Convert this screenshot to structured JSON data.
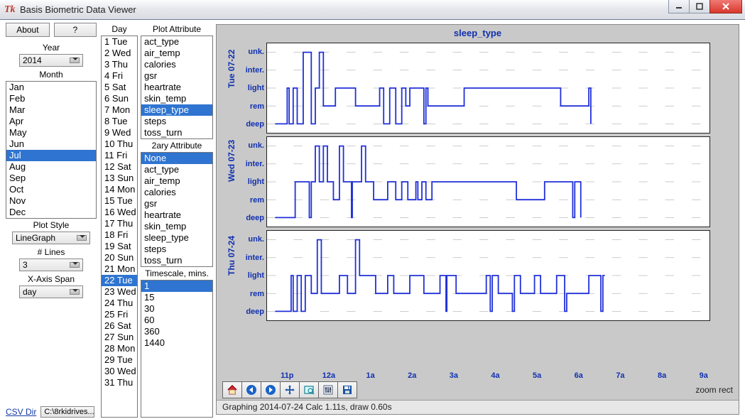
{
  "window": {
    "title": "Basis Biometric Data Viewer"
  },
  "buttons": {
    "about": "About",
    "help": "?",
    "csvdir": "CSV Dir",
    "pathbtn": "C:\\8rkidrives..."
  },
  "headers": {
    "year": "Year",
    "month": "Month",
    "day": "Day",
    "plot_attr": "Plot Attribute",
    "secondary_attr": "2ary Attribute",
    "timescale": "Timescale, mins.",
    "plot_style": "Plot Style",
    "num_lines": "# Lines",
    "xaxis_span": "X-Axis Span"
  },
  "dropdowns": {
    "year": "2014",
    "plot_style": "LineGraph",
    "num_lines": "3",
    "xaxis_span": "day"
  },
  "months": [
    "Jan",
    "Feb",
    "Mar",
    "Apr",
    "May",
    "Jun",
    "Jul",
    "Aug",
    "Sep",
    "Oct",
    "Nov",
    "Dec"
  ],
  "month_selected": "Jul",
  "days": [
    "1 Tue",
    "2 Wed",
    "3 Thu",
    "4 Fri",
    "5 Sat",
    "6 Sun",
    "7 Mon",
    "8 Tue",
    "9 Wed",
    "10 Thu",
    "11 Fri",
    "12 Sat",
    "13 Sun",
    "14 Mon",
    "15 Tue",
    "16 Wed",
    "17 Thu",
    "18 Fri",
    "19 Sat",
    "20 Sun",
    "21 Mon",
    "22 Tue",
    "23 Wed",
    "24 Thu",
    "25 Fri",
    "26 Sat",
    "27 Sun",
    "28 Mon",
    "29 Tue",
    "30 Wed",
    "31 Thu"
  ],
  "day_selected": "22 Tue",
  "plot_attrs": [
    "act_type",
    "air_temp",
    "calories",
    "gsr",
    "heartrate",
    "skin_temp",
    "sleep_type",
    "steps",
    "toss_turn"
  ],
  "plot_attr_selected": "sleep_type",
  "secondary_attrs": [
    "None",
    "act_type",
    "air_temp",
    "calories",
    "gsr",
    "heartrate",
    "skin_temp",
    "sleep_type",
    "steps",
    "toss_turn"
  ],
  "secondary_attr_selected": "None",
  "timescales": [
    "1",
    "15",
    "30",
    "60",
    "360",
    "1440"
  ],
  "timescale_selected": "1",
  "chart_data": {
    "type": "line",
    "title": "sleep_type",
    "y_categories": [
      "unk.",
      "inter.",
      "light",
      "rem",
      "deep"
    ],
    "x_categories": [
      "11p",
      "12a",
      "1a",
      "2a",
      "3a",
      "4a",
      "5a",
      "6a",
      "7a",
      "8a",
      "9a"
    ],
    "xlim": [
      22.5,
      33.5
    ],
    "panels": [
      {
        "label": "Tue 07-22",
        "series": [
          [
            22.7,
            4
          ],
          [
            23.0,
            4
          ],
          [
            23.0,
            2
          ],
          [
            23.05,
            2
          ],
          [
            23.05,
            4
          ],
          [
            23.15,
            4
          ],
          [
            23.15,
            2
          ],
          [
            23.25,
            2
          ],
          [
            23.25,
            4
          ],
          [
            23.4,
            4
          ],
          [
            23.4,
            0
          ],
          [
            23.6,
            0
          ],
          [
            23.6,
            4
          ],
          [
            23.7,
            4
          ],
          [
            23.7,
            2
          ],
          [
            23.8,
            2
          ],
          [
            23.8,
            0
          ],
          [
            23.9,
            0
          ],
          [
            23.9,
            3
          ],
          [
            24.2,
            3
          ],
          [
            24.2,
            2
          ],
          [
            24.7,
            2
          ],
          [
            24.7,
            3
          ],
          [
            25.3,
            3
          ],
          [
            25.3,
            2
          ],
          [
            25.4,
            2
          ],
          [
            25.4,
            4
          ],
          [
            25.55,
            4
          ],
          [
            25.55,
            2
          ],
          [
            25.7,
            2
          ],
          [
            25.7,
            4
          ],
          [
            25.85,
            4
          ],
          [
            25.85,
            2
          ],
          [
            25.95,
            2
          ],
          [
            25.95,
            3
          ],
          [
            26.05,
            3
          ],
          [
            26.05,
            2
          ],
          [
            26.4,
            2
          ],
          [
            26.4,
            4
          ],
          [
            26.45,
            4
          ],
          [
            26.45,
            2
          ],
          [
            26.5,
            2
          ],
          [
            26.5,
            3
          ],
          [
            27.4,
            3
          ],
          [
            27.4,
            2
          ],
          [
            29.8,
            2
          ],
          [
            29.8,
            3
          ],
          [
            30.5,
            3
          ],
          [
            30.5,
            2
          ],
          [
            30.55,
            2
          ],
          [
            30.55,
            4
          ],
          [
            30.55,
            2
          ]
        ]
      },
      {
        "label": "Wed 07-23",
        "series": [
          [
            22.7,
            4
          ],
          [
            23.2,
            4
          ],
          [
            23.2,
            2
          ],
          [
            23.55,
            2
          ],
          [
            23.55,
            4
          ],
          [
            23.6,
            4
          ],
          [
            23.6,
            2
          ],
          [
            23.7,
            2
          ],
          [
            23.7,
            0
          ],
          [
            23.8,
            0
          ],
          [
            23.8,
            2
          ],
          [
            23.9,
            2
          ],
          [
            23.9,
            0
          ],
          [
            24.0,
            0
          ],
          [
            24.0,
            2
          ],
          [
            24.15,
            2
          ],
          [
            24.15,
            3
          ],
          [
            24.3,
            3
          ],
          [
            24.3,
            0
          ],
          [
            24.4,
            0
          ],
          [
            24.4,
            2
          ],
          [
            24.6,
            2
          ],
          [
            24.6,
            4
          ],
          [
            24.62,
            4
          ],
          [
            24.62,
            2
          ],
          [
            24.85,
            2
          ],
          [
            24.85,
            0
          ],
          [
            24.95,
            0
          ],
          [
            24.95,
            2
          ],
          [
            25.15,
            2
          ],
          [
            25.15,
            3
          ],
          [
            25.5,
            3
          ],
          [
            25.5,
            2
          ],
          [
            25.7,
            2
          ],
          [
            25.7,
            3
          ],
          [
            25.85,
            3
          ],
          [
            25.85,
            2
          ],
          [
            26.0,
            2
          ],
          [
            26.0,
            3
          ],
          [
            26.2,
            3
          ],
          [
            26.2,
            2
          ],
          [
            26.25,
            2
          ],
          [
            26.25,
            3
          ],
          [
            26.35,
            3
          ],
          [
            26.35,
            2
          ],
          [
            26.45,
            2
          ],
          [
            26.45,
            3
          ],
          [
            26.6,
            3
          ],
          [
            26.6,
            2
          ],
          [
            28.7,
            2
          ],
          [
            28.7,
            3
          ],
          [
            29.4,
            3
          ],
          [
            29.4,
            2
          ],
          [
            30.1,
            2
          ],
          [
            30.1,
            4
          ],
          [
            30.15,
            4
          ],
          [
            30.15,
            2
          ],
          [
            30.3,
            2
          ],
          [
            30.3,
            4
          ],
          [
            30.3,
            2
          ]
        ]
      },
      {
        "label": "Thu 07-24",
        "series": [
          [
            22.7,
            4
          ],
          [
            23.1,
            4
          ],
          [
            23.1,
            2
          ],
          [
            23.15,
            2
          ],
          [
            23.15,
            4
          ],
          [
            23.25,
            4
          ],
          [
            23.25,
            2
          ],
          [
            23.35,
            2
          ],
          [
            23.35,
            4
          ],
          [
            23.45,
            4
          ],
          [
            23.45,
            2
          ],
          [
            23.6,
            2
          ],
          [
            23.6,
            3
          ],
          [
            23.75,
            3
          ],
          [
            23.75,
            0
          ],
          [
            23.85,
            0
          ],
          [
            23.85,
            3
          ],
          [
            24.3,
            3
          ],
          [
            24.3,
            2
          ],
          [
            24.5,
            2
          ],
          [
            24.5,
            3
          ],
          [
            24.7,
            3
          ],
          [
            24.7,
            0
          ],
          [
            24.8,
            0
          ],
          [
            24.8,
            2
          ],
          [
            25.2,
            2
          ],
          [
            25.2,
            3
          ],
          [
            25.5,
            3
          ],
          [
            25.5,
            2
          ],
          [
            25.65,
            2
          ],
          [
            25.65,
            3
          ],
          [
            26.05,
            3
          ],
          [
            26.05,
            2
          ],
          [
            26.4,
            2
          ],
          [
            26.4,
            3
          ],
          [
            26.8,
            3
          ],
          [
            26.8,
            2
          ],
          [
            26.95,
            2
          ],
          [
            26.95,
            4
          ],
          [
            26.97,
            4
          ],
          [
            26.97,
            2
          ],
          [
            27.2,
            2
          ],
          [
            27.2,
            3
          ],
          [
            27.95,
            3
          ],
          [
            27.95,
            2
          ],
          [
            28.05,
            2
          ],
          [
            28.05,
            4
          ],
          [
            28.1,
            4
          ],
          [
            28.1,
            2
          ],
          [
            28.25,
            2
          ],
          [
            28.25,
            3
          ],
          [
            28.6,
            3
          ],
          [
            28.6,
            4
          ],
          [
            28.65,
            4
          ],
          [
            28.65,
            2
          ],
          [
            28.8,
            2
          ],
          [
            28.8,
            3
          ],
          [
            29.15,
            3
          ],
          [
            29.15,
            2
          ],
          [
            29.3,
            2
          ],
          [
            29.3,
            3
          ],
          [
            29.7,
            3
          ],
          [
            29.7,
            2
          ],
          [
            29.9,
            2
          ],
          [
            29.9,
            4
          ],
          [
            29.95,
            4
          ],
          [
            29.95,
            3
          ],
          [
            30.5,
            3
          ],
          [
            30.5,
            2
          ],
          [
            30.8,
            2
          ],
          [
            30.8,
            4
          ],
          [
            30.85,
            4
          ],
          [
            30.85,
            2
          ],
          [
            30.9,
            2
          ]
        ]
      }
    ]
  },
  "toolbar": {
    "zoom_label": "zoom rect"
  },
  "status": "Graphing 2014-07-24 Calc 1.11s, draw 0.60s"
}
